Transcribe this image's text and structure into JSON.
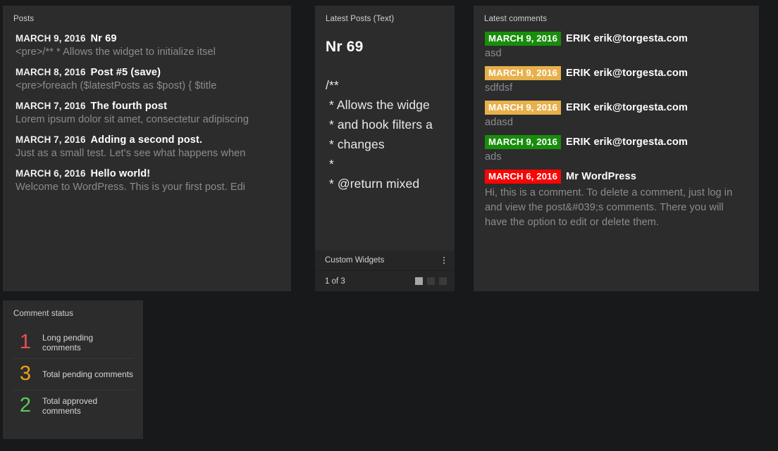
{
  "theme": {
    "page_background": "#17191b",
    "panel_background": "#2c2c2c",
    "footer_background": "#262626",
    "approved_color": "#188d0c",
    "pending_color": "#e8b04b",
    "long_pending_color": "#fa0505",
    "muted_text": "#8a8c8d"
  },
  "posts_panel": {
    "title": "Posts",
    "items": [
      {
        "date": "MARCH 9, 2016",
        "title": "Nr 69",
        "excerpt": "<pre>/** * Allows the widget to initialize itsel"
      },
      {
        "date": "MARCH 8, 2016",
        "title": "Post #5 (save)",
        "excerpt": "<pre>foreach ($latestPosts as $post) { $title"
      },
      {
        "date": "MARCH 7, 2016",
        "title": "The fourth post",
        "excerpt": "Lorem ipsum dolor sit amet, consectetur adipiscing"
      },
      {
        "date": "MARCH 7, 2016",
        "title": "Adding a second post.",
        "excerpt": "Just as a small test. Let's see what happens when"
      },
      {
        "date": "MARCH 6, 2016",
        "title": "Hello world!",
        "excerpt": "Welcome to WordPress. This is your first post. Edi"
      }
    ]
  },
  "latest_posts_text_panel": {
    "title": "Latest Posts (Text)",
    "heading": "Nr 69",
    "body": "/**\n * Allows the widge\n * and hook filters a\n * changes\n *\n * @return mixed",
    "footer": {
      "label": "Custom Widgets",
      "menu_icon": "kebab-menu-icon",
      "counter": "1 of 3",
      "dots_total": 3,
      "dots_active_index": 0
    }
  },
  "comments_panel": {
    "title": "Latest comments",
    "items": [
      {
        "date": "MARCH 9, 2016",
        "status": "approved",
        "author": "ERIK erik@torgesta.com",
        "text": "asd",
        "wrap": false
      },
      {
        "date": "MARCH 9, 2016",
        "status": "pending",
        "author": "ERIK erik@torgesta.com",
        "text": "sdfdsf",
        "wrap": false
      },
      {
        "date": "MARCH 9, 2016",
        "status": "pending",
        "author": "ERIK erik@torgesta.com",
        "text": "adasd",
        "wrap": false
      },
      {
        "date": "MARCH 9, 2016",
        "status": "approved",
        "author": "ERIK erik@torgesta.com",
        "text": "ads",
        "wrap": false
      },
      {
        "date": "MARCH 6, 2016",
        "status": "longpending",
        "author": "Mr WordPress",
        "text": "Hi, this is a comment. To delete a comment, just log in and view the post&#039;s comments. There you will have the option to edit or delete them.",
        "wrap": true
      }
    ]
  },
  "comment_status_panel": {
    "title": "Comment status",
    "rows": [
      {
        "count": "1",
        "label": "Long pending comments",
        "color_class": "red"
      },
      {
        "count": "3",
        "label": "Total pending comments",
        "color_class": "amber"
      },
      {
        "count": "2",
        "label": "Total approved comments",
        "color_class": "green"
      }
    ]
  }
}
